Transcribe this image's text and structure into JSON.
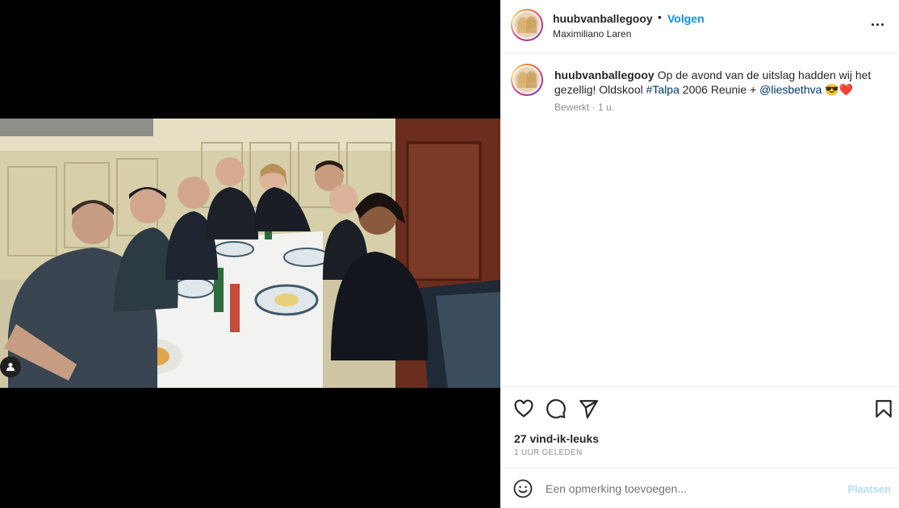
{
  "post": {
    "username": "huubvanballegooy",
    "separator": "•",
    "follow_label": "Volgen",
    "location": "Maximiliano Laren",
    "caption_before_tag": "Op de avond van de uitslag hadden wij het gezellig! Oldskool ",
    "hashtag": "#Talpa",
    "caption_middle": " 2006 Reunie + ",
    "mention": "@liesbethva",
    "caption_emoji": "😎❤️",
    "edited_label": "Bewerkt · 1 u.",
    "likes": "27 vind-ik-leuks",
    "time_ago": "1 UUR GELEDEN"
  },
  "comment": {
    "placeholder": "Een opmerking toevoegen...",
    "post_label": "Plaatsen"
  },
  "icons": {
    "like": "heart-icon",
    "comment": "comment-icon",
    "share": "send-icon",
    "save": "bookmark-icon",
    "more": "more-icon",
    "emoji": "emoji-icon",
    "tag": "user-tag-icon"
  },
  "colors": {
    "accent": "#0095f6",
    "link": "#00376b",
    "muted": "#8e8e8e",
    "post_disabled": "#b2dffc"
  }
}
